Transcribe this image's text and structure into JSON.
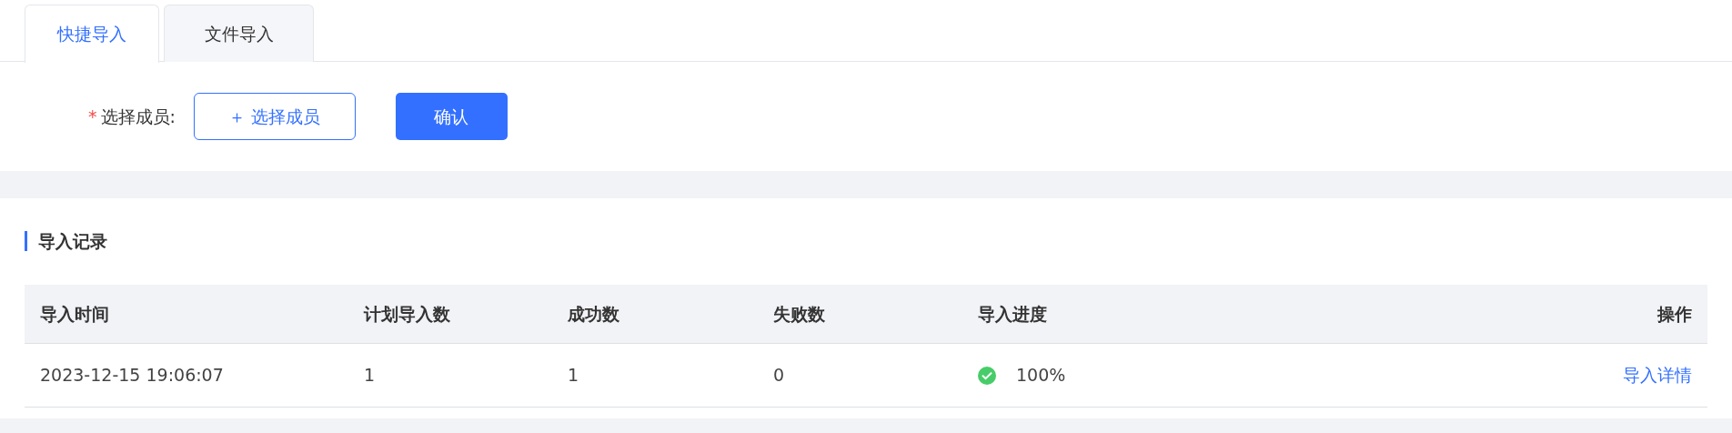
{
  "tabs": [
    {
      "label": "快捷导入",
      "selected": true
    },
    {
      "label": "文件导入",
      "selected": false
    }
  ],
  "form": {
    "label": "选择成员:",
    "required_mark": "*",
    "select_button": "＋ 选择成员",
    "confirm_button": "确认"
  },
  "records": {
    "title": "导入记录",
    "columns": [
      "导入时间",
      "计划导入数",
      "成功数",
      "失败数",
      "导入进度",
      "操作"
    ],
    "rows": [
      {
        "time": "2023-12-15 19:06:07",
        "planned": "1",
        "success": "1",
        "failed": "0",
        "kind": "success",
        "progress": "100%",
        "action": "导入详情"
      }
    ]
  }
}
